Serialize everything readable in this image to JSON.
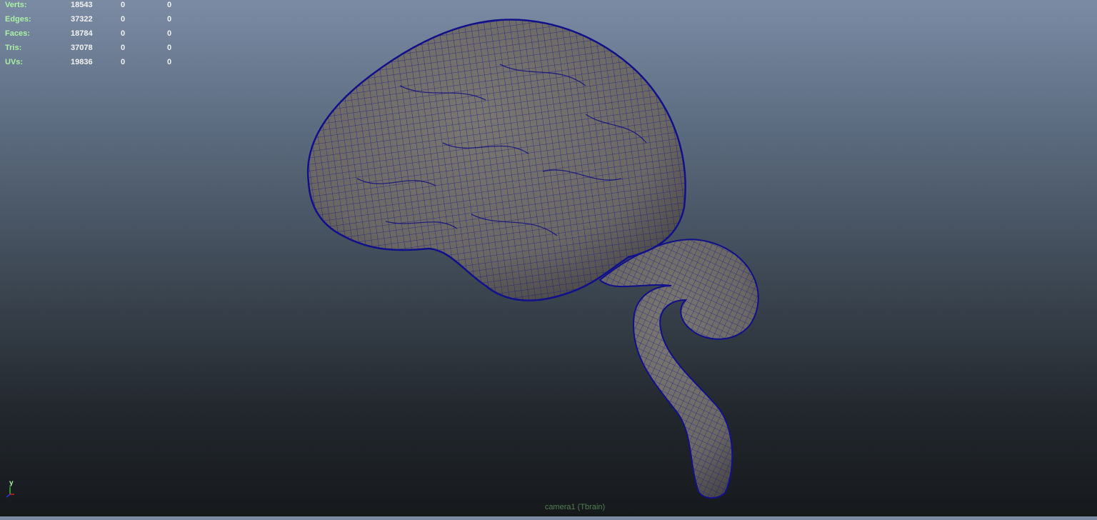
{
  "hud": {
    "rows": [
      {
        "label": "Verts:",
        "v1": "18543",
        "v2": "0",
        "v3": "0"
      },
      {
        "label": "Edges:",
        "v1": "37322",
        "v2": "0",
        "v3": "0"
      },
      {
        "label": "Faces:",
        "v1": "18784",
        "v2": "0",
        "v3": "0"
      },
      {
        "label": "Tris:",
        "v1": "37078",
        "v2": "0",
        "v3": "0"
      },
      {
        "label": "UVs:",
        "v1": "19836",
        "v2": "0",
        "v3": "0"
      }
    ]
  },
  "camera_label": "camera1 (Tbrain)",
  "axis": {
    "y_label": "y"
  },
  "colors": {
    "wireframe": "#14148c",
    "mesh_fill": "#6b6864",
    "hud_label": "#a9f2a4",
    "hud_value": "#f2f2f2"
  }
}
